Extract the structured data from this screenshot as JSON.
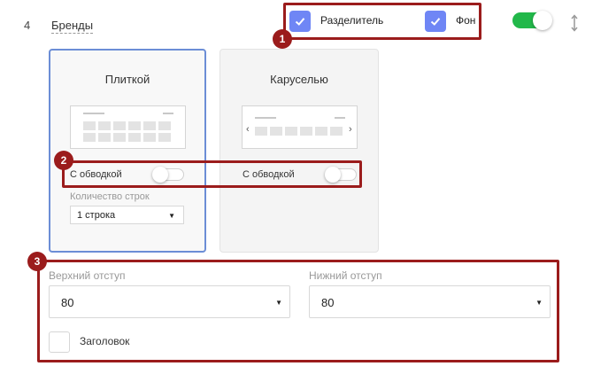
{
  "row": {
    "number": "4",
    "title": "Бренды"
  },
  "header_options": {
    "divider": {
      "label": "Разделитель",
      "checked": true
    },
    "background": {
      "label": "Фон",
      "checked": true
    },
    "enabled": true
  },
  "badges": [
    "1",
    "2",
    "3"
  ],
  "layouts": [
    {
      "title": "Плиткой",
      "selected": true,
      "border_label": "С обводкой",
      "border_on": false
    },
    {
      "title": "Каруселью",
      "selected": false,
      "border_label": "С обводкой",
      "border_on": false
    }
  ],
  "rows_count": {
    "label": "Количество строк",
    "value": "1 строка"
  },
  "carousel_arrows": {
    "left": "‹",
    "right": "›"
  },
  "padding": {
    "top": {
      "label": "Верхний отступ",
      "value": "80"
    },
    "bottom": {
      "label": "Нижний отступ",
      "value": "80"
    }
  },
  "heading": {
    "label": "Заголовок",
    "checked": false
  },
  "colors": {
    "accent_checkbox": "#6f86f5",
    "toggle_on": "#22b84a",
    "highlight": "#9b1c1c",
    "selected_border": "#6c8ed6"
  }
}
